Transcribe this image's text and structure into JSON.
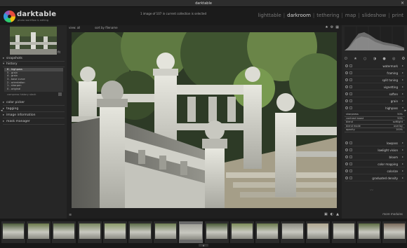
{
  "window": {
    "title": "darktable",
    "close_label": "×"
  },
  "header": {
    "brand": "darktable",
    "tagline": "photo workflow & editing",
    "info": "1 image of 107 in current collection is selected",
    "views": [
      {
        "label": "lighttable",
        "active": false
      },
      {
        "label": "darkroom",
        "active": true
      },
      {
        "label": "tethering",
        "active": false
      },
      {
        "label": "map",
        "active": false
      },
      {
        "label": "slideshow",
        "active": false
      },
      {
        "label": "print",
        "active": false
      }
    ]
  },
  "left_panel": {
    "zoom_label": "fit",
    "sections": {
      "snapshots": "snapshots",
      "history": "history",
      "color_picker": "color picker",
      "tagging": "tagging",
      "image_information": "image information",
      "mask_manager": "mask manager"
    },
    "history_items": [
      {
        "label": "6 - highpass",
        "selected": true
      },
      {
        "label": "5 - grain",
        "selected": false
      },
      {
        "label": "4 - grain",
        "selected": false
      },
      {
        "label": "3 - base curve",
        "selected": false
      },
      {
        "label": "2 - orientation",
        "selected": false
      },
      {
        "label": "1 - sharpen",
        "selected": false
      },
      {
        "label": "0 - original",
        "selected": false
      }
    ],
    "compress_label": "compress history stack"
  },
  "center": {
    "view_label": "view: all",
    "sort_label": "sort by  filename",
    "top_icons": [
      "star-icon",
      "gear-icon",
      "grid-icon"
    ],
    "bottom_icons": [
      "display-icon",
      "mask-icon",
      "warning-icon"
    ]
  },
  "right_panel": {
    "modules": [
      {
        "name": "watermark",
        "expanded": false
      },
      {
        "name": "framing",
        "expanded": false
      },
      {
        "name": "split toning",
        "expanded": false
      },
      {
        "name": "vignetting",
        "expanded": false
      },
      {
        "name": "soften",
        "expanded": false
      },
      {
        "name": "grain",
        "expanded": false
      },
      {
        "name": "highpass",
        "expanded": true
      }
    ],
    "highpass_params": [
      {
        "key": "sharpness",
        "value": "50%"
      },
      {
        "key": "contrast boost",
        "value": "50%"
      },
      {
        "key": "blend",
        "value": "softlight"
      },
      {
        "key": "blend mode",
        "value": "overlay"
      },
      {
        "key": "opacity",
        "value": "100%"
      }
    ],
    "modules_after": [
      {
        "name": "lowpass"
      },
      {
        "name": "lowlight vision"
      },
      {
        "name": "bloom"
      },
      {
        "name": "color mapping"
      },
      {
        "name": "colorize"
      },
      {
        "name": "graduated density"
      }
    ],
    "more_modules": "more modules"
  },
  "filmstrip": {
    "frame_count": 16,
    "selected_index": 7,
    "handle": "▲"
  },
  "colors": {
    "accent": "#d8d8d8",
    "panel_bg": "#262626",
    "center_bg": "#1f1f1f"
  }
}
